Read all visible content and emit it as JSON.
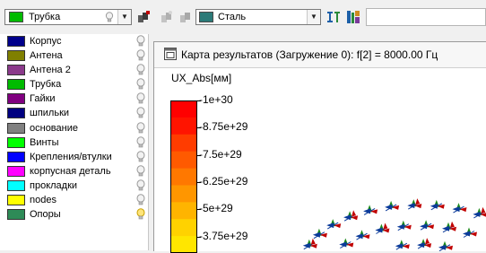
{
  "toolbar": {
    "layer_combo": {
      "value": "Трубка",
      "color": "#00bb00"
    },
    "material_combo": {
      "value": "Сталь",
      "color": "#2b7a78"
    }
  },
  "layers": [
    {
      "name": "Корпус",
      "color": "#00008b",
      "highlighted": false
    },
    {
      "name": "Антена",
      "color": "#808000",
      "highlighted": false
    },
    {
      "name": "Антена 2",
      "color": "#8b3a8b",
      "highlighted": false
    },
    {
      "name": "Трубка",
      "color": "#00bb00",
      "highlighted": false
    },
    {
      "name": "Гайки",
      "color": "#800080",
      "highlighted": false
    },
    {
      "name": "шпильки",
      "color": "#000080",
      "highlighted": false
    },
    {
      "name": "основание",
      "color": "#808080",
      "highlighted": false
    },
    {
      "name": "Винты",
      "color": "#00ff00",
      "highlighted": false
    },
    {
      "name": "Крепления/втулки",
      "color": "#0000ff",
      "highlighted": false
    },
    {
      "name": "корпусная деталь",
      "color": "#ff00ff",
      "highlighted": false
    },
    {
      "name": "прокладки",
      "color": "#00ffff",
      "highlighted": false
    },
    {
      "name": "nodes",
      "color": "#ffff00",
      "highlighted": false
    },
    {
      "name": "Опоры",
      "color": "#2e8b57",
      "highlighted": true
    }
  ],
  "results_window": {
    "title": "Карта результатов (Загружение 0): f[2] = 8000.00 Гц"
  },
  "color_scale": {
    "title": "UX_Abs[мм]",
    "ticks": [
      "-1e+30",
      "-8.75e+29",
      "-7.5e+29",
      "-6.25e+29",
      "-5e+29",
      "-3.75e+29"
    ],
    "colors": [
      "#ff0000",
      "#ff1400",
      "#ff3c00",
      "#ff5a00",
      "#ff7800",
      "#ff9600",
      "#ffb400",
      "#ffd200",
      "#ffe600"
    ]
  }
}
